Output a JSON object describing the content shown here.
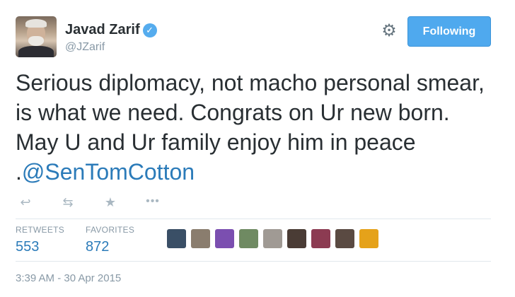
{
  "author": {
    "name": "Javad Zarif",
    "handle": "@JZarif",
    "verified_glyph": "✓"
  },
  "header": {
    "settings_icon": "⚙",
    "follow_label": "Following"
  },
  "tweet": {
    "text_before_mention": "Serious diplomacy, not macho personal smear, is what we need. Congrats on Ur new born. May U and Ur family enjoy him in peace .",
    "mention": "@SenTomCotton"
  },
  "actions": {
    "reply_icon": "↩",
    "retweet_icon": "⇆",
    "favorite_icon": "★",
    "more_icon": "•••"
  },
  "stats": {
    "retweets_label": "RETWEETS",
    "retweets_count": "553",
    "favorites_label": "FAVORITES",
    "favorites_count": "872"
  },
  "favoriter_avatars": [
    {
      "color": "#3a4f66"
    },
    {
      "color": "#8a7d6e"
    },
    {
      "color": "#7b4fb0"
    },
    {
      "color": "#6f8a62"
    },
    {
      "color": "#a09a94"
    },
    {
      "color": "#4a3c35"
    },
    {
      "color": "#8c3b52"
    },
    {
      "color": "#5a4a42"
    },
    {
      "color": "#e5a21a"
    }
  ],
  "timestamp": "3:39 AM - 30 Apr 2015",
  "colors": {
    "link": "#2b7bb9",
    "button": "#4fa9ee",
    "muted": "#8899a6"
  }
}
